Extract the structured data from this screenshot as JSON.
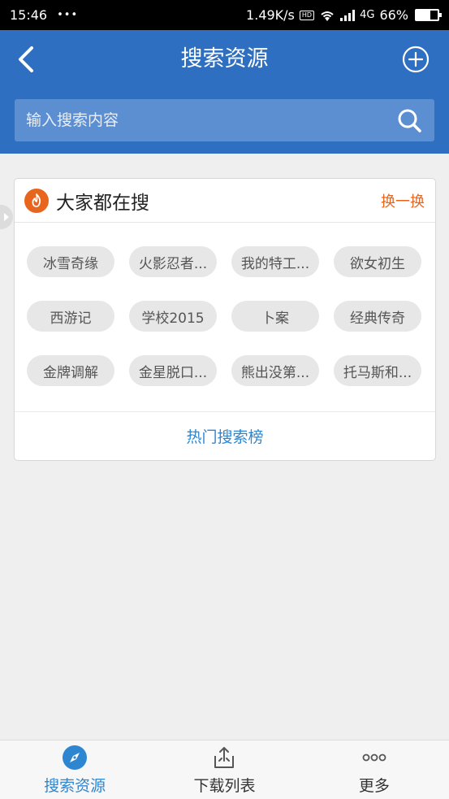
{
  "status_bar": {
    "time": "15:46",
    "dots": "•••",
    "net_speed": "1.49K/s",
    "hd": "HD",
    "network": "4G",
    "battery_pct": "66%",
    "battery_level": 0.66
  },
  "header": {
    "title": "搜索资源",
    "search_placeholder": "输入搜索内容"
  },
  "hot": {
    "title": "大家都在搜",
    "refresh_label": "换一换",
    "tags": [
      "冰雪奇缘",
      "火影忍者...",
      "我的特工...",
      "欲女初生",
      "西游记",
      "学校2015",
      "卜案",
      "经典传奇",
      "金牌调解",
      "金星脱口...",
      "熊出没第...",
      "托马斯和..."
    ],
    "footer_link": "热门搜索榜"
  },
  "bottom_nav": {
    "items": [
      {
        "label": "搜索资源",
        "icon": "compass-icon",
        "active": true
      },
      {
        "label": "下载列表",
        "icon": "download-tray-icon",
        "active": false
      },
      {
        "label": "更多",
        "icon": "more-dots-icon",
        "active": false
      }
    ]
  },
  "colors": {
    "header_bg": "#2f6fc1",
    "accent_blue": "#2f86d0",
    "accent_orange": "#e8651e"
  }
}
